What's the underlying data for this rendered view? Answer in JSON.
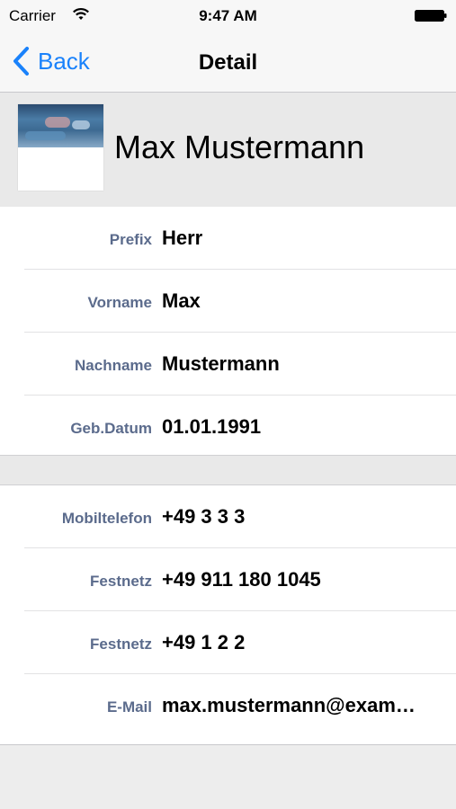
{
  "status_bar": {
    "carrier": "Carrier",
    "time": "9:47 AM"
  },
  "nav_bar": {
    "back_label": "Back",
    "title": "Detail"
  },
  "contact": {
    "name": "Max Mustermann"
  },
  "personal_fields": [
    {
      "label": "Prefix",
      "value": "Herr"
    },
    {
      "label": "Vorname",
      "value": "Max"
    },
    {
      "label": "Nachname",
      "value": "Mustermann"
    },
    {
      "label": "Geb.Datum",
      "value": "01.01.1991"
    }
  ],
  "contact_fields": [
    {
      "label": "Mobiltelefon",
      "value": "+49 3 3 3"
    },
    {
      "label": "Festnetz",
      "value": "+49 911 180 1045"
    },
    {
      "label": "Festnetz",
      "value": "+49 1 2 2"
    },
    {
      "label": "E-Mail",
      "value": "max.mustermann@exam…"
    }
  ],
  "colors": {
    "accent": "#1a82fb",
    "label": "#5b6b8c",
    "grouped_background": "#e9e9e9"
  },
  "icons": {
    "back": "chevron-left-icon",
    "wifi": "wifi-icon",
    "battery": "battery-icon"
  }
}
